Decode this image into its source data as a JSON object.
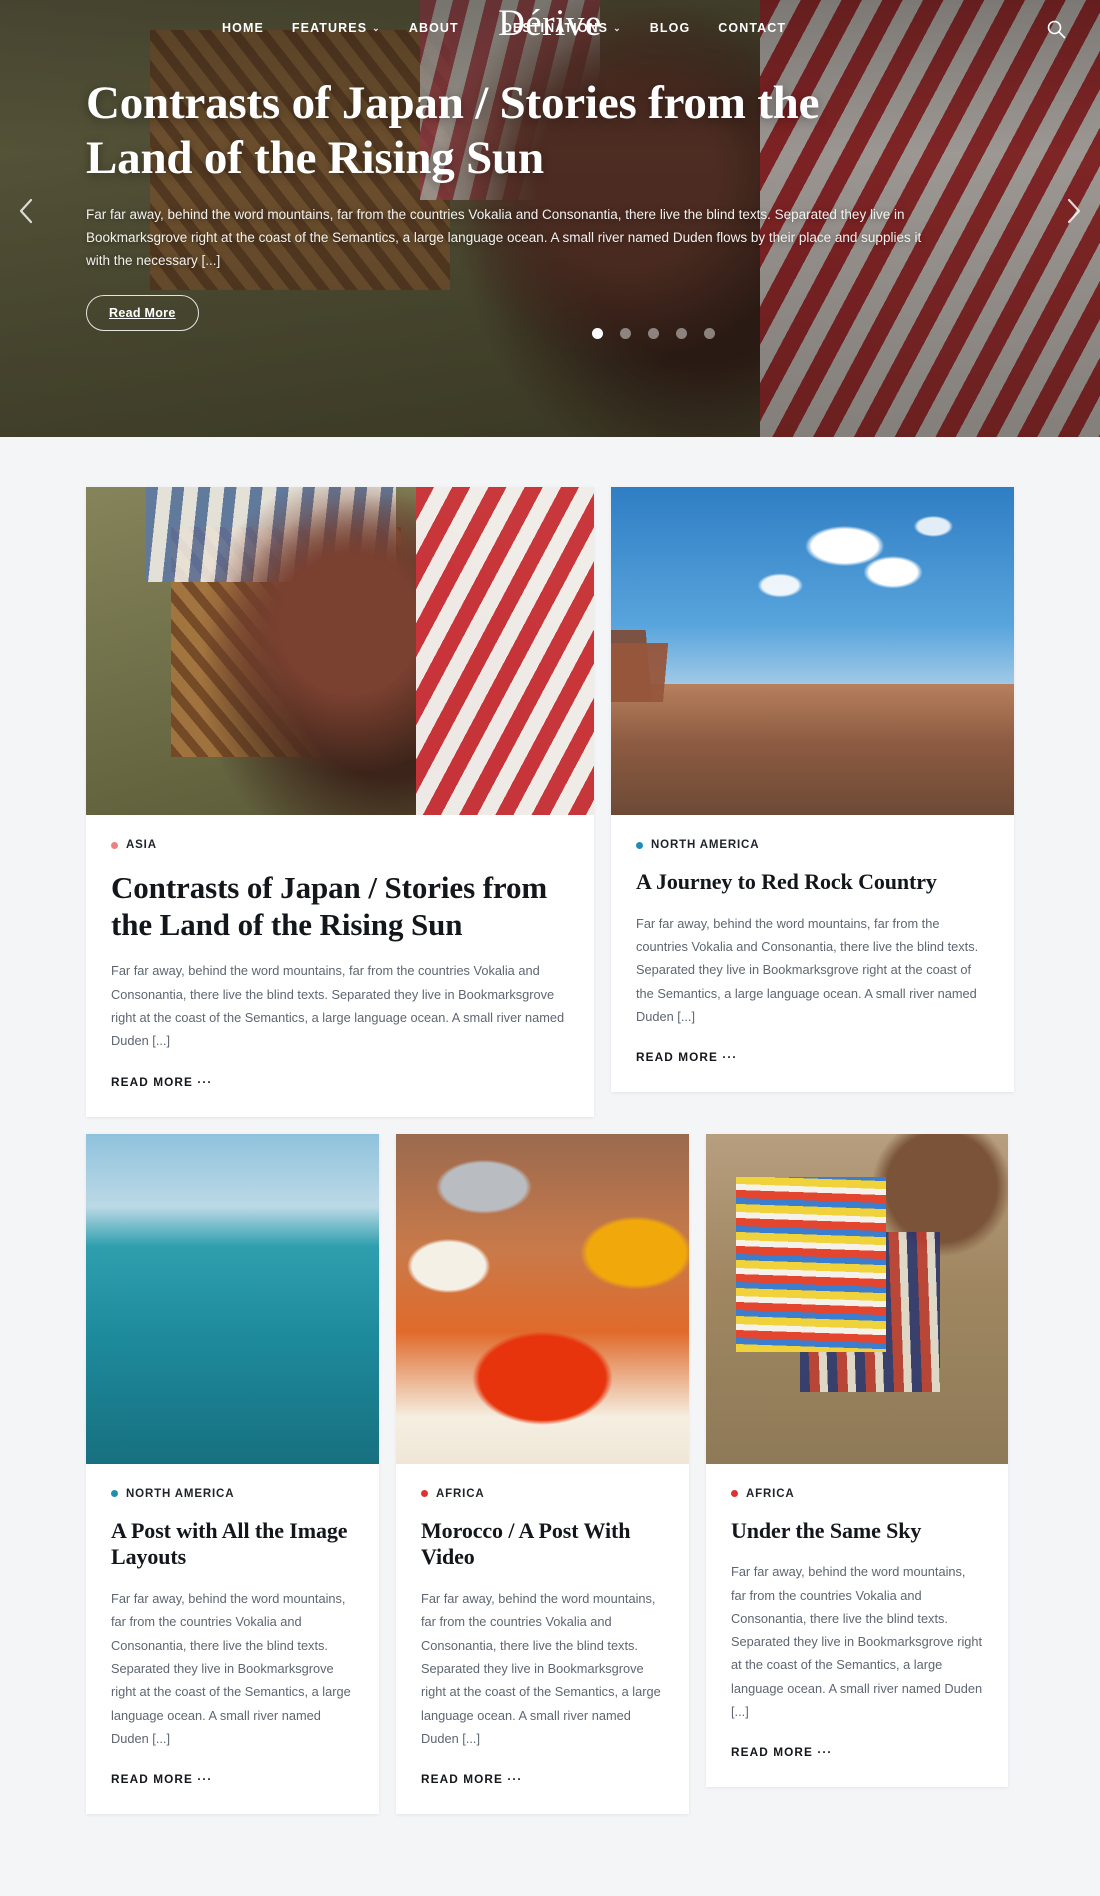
{
  "nav": {
    "left_items": [
      {
        "label": "HOME",
        "has_caret": false
      },
      {
        "label": "FEATURES",
        "has_caret": true
      },
      {
        "label": "ABOUT",
        "has_caret": false
      }
    ],
    "right_items": [
      {
        "label": "DESTINATIONS",
        "has_caret": true
      },
      {
        "label": "BLOG",
        "has_caret": false
      },
      {
        "label": "CONTACT",
        "has_caret": false
      }
    ],
    "brand": "Dérive",
    "search_icon": "search-icon",
    "caret_glyph": "⌄"
  },
  "hero": {
    "title": "Contrasts of Japan / Stories from the Land of the Rising Sun",
    "description": "Far far away, behind the word mountains, far from the countries Vokalia and Consonantia, there live the blind texts. Separated they live in Bookmarksgrove right at the coast of the Semantics, a large language ocean. A small river named Duden flows by their place and supplies it with the necessary [...]",
    "button_label": "Read More",
    "prev_icon": "chevron-left-icon",
    "next_icon": "chevron-right-icon",
    "prev_glyph": "‹",
    "next_glyph": "›",
    "slide_count": 5,
    "active_slide": 1
  },
  "colors": {
    "cat_asia": "#f08080",
    "cat_north_america": "#1f8fb0",
    "cat_africa": "#e03131",
    "page_bg": "#f4f5f7",
    "card_bg": "#ffffff",
    "title_color": "#13161a",
    "body_text": "#5f6671"
  },
  "posts": [
    {
      "category": "ASIA",
      "category_color": "#f08080",
      "title": "Contrasts of Japan / Stories from the Land of the Rising Sun",
      "excerpt": "Far far away, behind the word mountains, far from the countries Vokalia and Consonantia, there live the blind texts. Separated they live in Bookmarksgrove right at the coast of the Semantics, a large language ocean. A small river named Duden [...]",
      "read_more": "READ MORE ···",
      "image_name": "japan-umbrellas-photo"
    },
    {
      "category": "NORTH AMERICA",
      "category_color": "#1f8fb0",
      "title": "A Journey to Red Rock Country",
      "excerpt": "Far far away, behind the word mountains, far from the countries Vokalia and Consonantia, there live the blind texts. Separated they live in Bookmarksgrove right at the coast of the Semantics, a large language ocean. A small river named Duden [...]",
      "read_more": "READ MORE ···",
      "image_name": "red-rock-canyon-photo"
    },
    {
      "category": "NORTH AMERICA",
      "category_color": "#1f8fb0",
      "title": "A Post with All the Image Layouts",
      "excerpt": "Far far away, behind the word mountains, far from the countries Vokalia and Consonantia, there live the blind texts. Separated they live in Bookmarksgrove right at the coast of the Semantics, a large language ocean. A small river named Duden [...]",
      "read_more": "READ MORE ···",
      "image_name": "golden-gate-bridge-photo"
    },
    {
      "category": "AFRICA",
      "category_color": "#e03131",
      "title": "Morocco / A Post With Video",
      "excerpt": "Far far away, behind the word mountains, far from the countries Vokalia and Consonantia, there live the blind texts. Separated they live in Bookmarksgrove right at the coast of the Semantics, a large language ocean. A small river named Duden [...]",
      "read_more": "READ MORE ···",
      "image_name": "spice-market-photo"
    },
    {
      "category": "AFRICA",
      "category_color": "#e03131",
      "title": "Under the Same Sky",
      "excerpt": "Far far away, behind the word mountains, far from the countries Vokalia and Consonantia, there live the blind texts. Separated they live in Bookmarksgrove right at the coast of the Semantics, a large language ocean. A small river named Duden [...]",
      "read_more": "READ MORE ···",
      "image_name": "tribal-dress-photo"
    }
  ]
}
